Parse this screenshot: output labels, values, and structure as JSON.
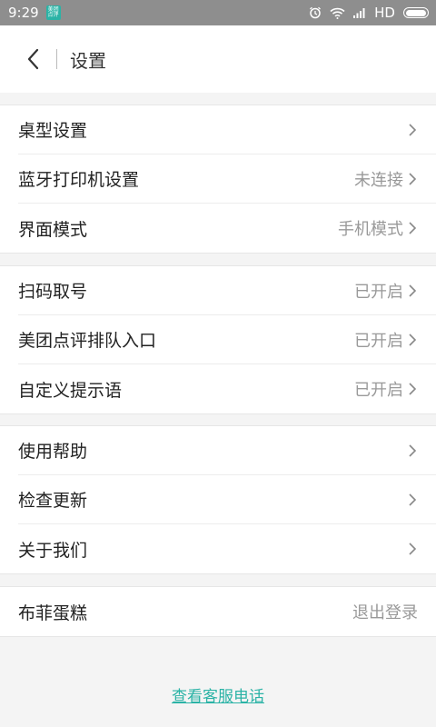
{
  "status_bar": {
    "time": "9:29",
    "app_icon_text": "美团\n点评",
    "network": "HD",
    "icons": [
      "alarm-icon",
      "wifi-icon",
      "signal-icon",
      "battery-icon"
    ]
  },
  "header": {
    "title": "设置",
    "back_icon": "back-arrow-icon"
  },
  "groups": [
    {
      "items": [
        {
          "label": "桌型设置",
          "value": ""
        },
        {
          "label": "蓝牙打印机设置",
          "value": "未连接"
        },
        {
          "label": "界面模式",
          "value": "手机模式"
        }
      ]
    },
    {
      "items": [
        {
          "label": "扫码取号",
          "value": "已开启"
        },
        {
          "label": "美团点评排队入口",
          "value": "已开启"
        },
        {
          "label": "自定义提示语",
          "value": "已开启"
        }
      ]
    },
    {
      "items": [
        {
          "label": "使用帮助",
          "value": ""
        },
        {
          "label": "检查更新",
          "value": ""
        },
        {
          "label": "关于我们",
          "value": ""
        }
      ]
    },
    {
      "items": [
        {
          "label": "布菲蛋糕",
          "value": "退出登录"
        }
      ]
    }
  ],
  "footer": {
    "link": "查看客服电话"
  },
  "colors": {
    "accent": "#2bb3a6",
    "status_bar": "#8e8e8e",
    "background": "#f4f4f4"
  }
}
